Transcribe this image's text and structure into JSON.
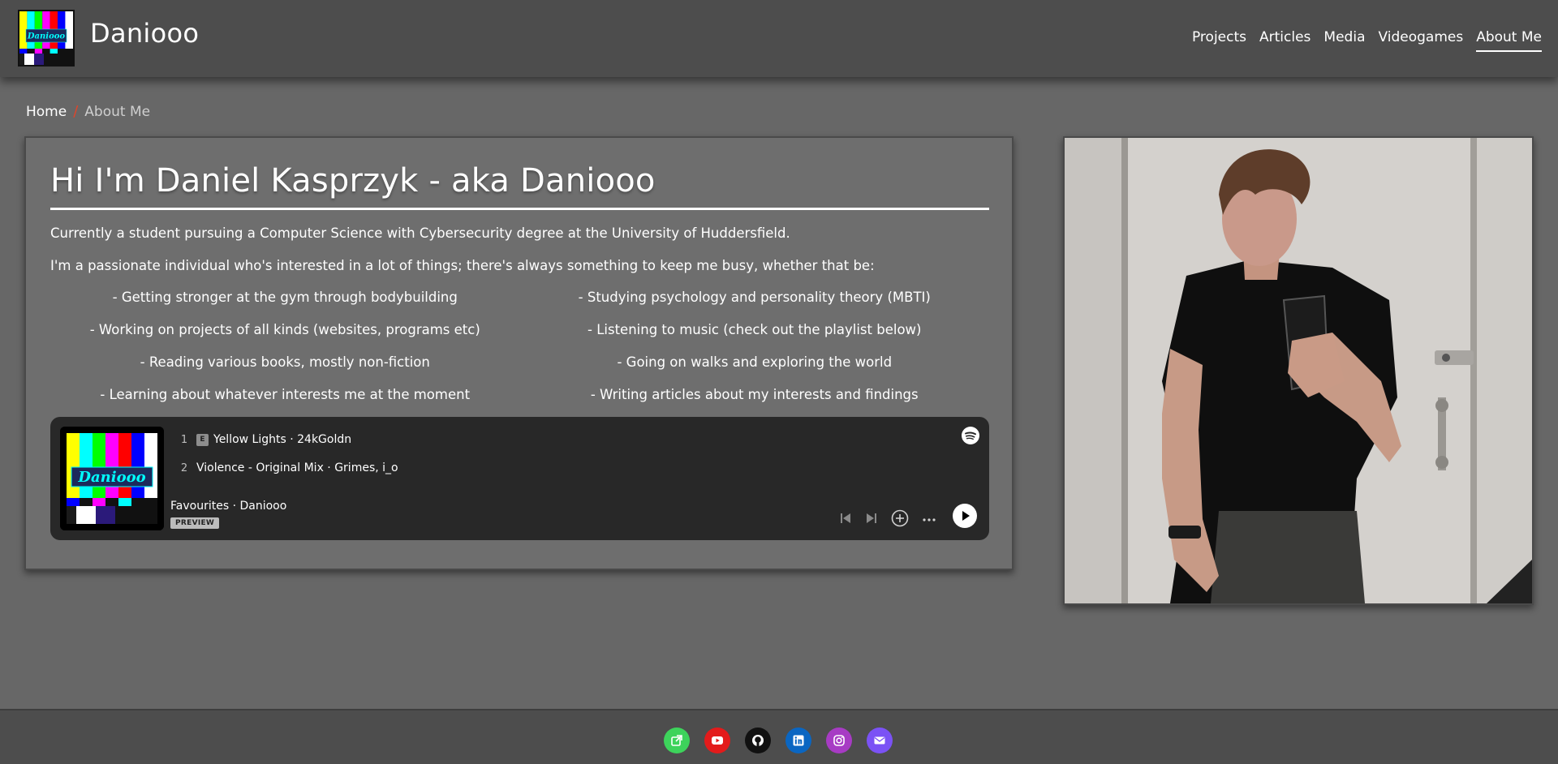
{
  "header": {
    "title": "Daniooo",
    "logo_text": "Daniooo",
    "nav": [
      {
        "label": "Projects"
      },
      {
        "label": "Articles"
      },
      {
        "label": "Media"
      },
      {
        "label": "Videogames"
      },
      {
        "label": "About Me"
      }
    ],
    "active_nav": "About Me"
  },
  "breadcrumb": {
    "home": "Home",
    "separator": "/",
    "current": "About Me"
  },
  "about": {
    "heading": "Hi I'm Daniel Kasprzyk - aka Daniooo",
    "intro": "Currently a student pursuing a Computer Science with Cybersecurity degree at the University of Huddersfield.",
    "interests_intro": "I'm a passionate individual who's interested in a lot of things; there's always something to keep me busy, whether that be:",
    "interests": [
      "- Getting stronger at the gym through bodybuilding",
      "- Studying psychology and personality theory (MBTI)",
      "- Working on projects of all kinds (websites, programs etc)",
      "- Listening to music (check out the playlist below)",
      "- Reading various books, mostly non-fiction",
      "- Going on walks and exploring the world",
      "- Learning about whatever interests me at the moment",
      "- Writing articles about my interests and findings"
    ]
  },
  "spotify": {
    "album_text": "Daniooo",
    "tracks": [
      {
        "num": "1",
        "explicit": "E",
        "title": "Yellow Lights · 24kGoldn"
      },
      {
        "num": "2",
        "title": "Violence - Original Mix · Grimes, i_o"
      }
    ],
    "playlist": "Favourites · Daniooo",
    "badge": "PREVIEW",
    "icons": {
      "logo": "spotify-icon",
      "prev": "skip-back-icon",
      "next": "skip-forward-icon",
      "save": "add-circle-icon",
      "more": "more-icon",
      "play": "play-icon"
    }
  },
  "photo": {
    "icon": "profile-photo"
  },
  "footer": {
    "socials": [
      {
        "name": "website-link-icon",
        "color": "#3dd35b"
      },
      {
        "name": "youtube-icon",
        "color": "#e31b1b"
      },
      {
        "name": "github-icon",
        "color": "#111111"
      },
      {
        "name": "linkedin-icon",
        "color": "#0a66c2"
      },
      {
        "name": "instagram-icon",
        "color": "#a73bc4"
      },
      {
        "name": "email-icon",
        "color": "#7b52f5"
      }
    ]
  }
}
